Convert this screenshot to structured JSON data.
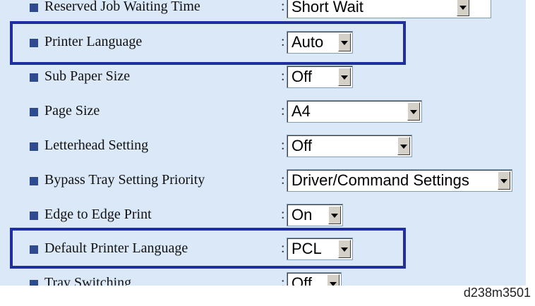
{
  "settings": [
    {
      "label": "Reserved Job Waiting Time",
      "value": "Short Wait"
    },
    {
      "label": "Printer Language",
      "value": "Auto"
    },
    {
      "label": "Sub Paper Size",
      "value": "Off"
    },
    {
      "label": "Page Size",
      "value": "A4"
    },
    {
      "label": "Letterhead Setting",
      "value": "Off"
    },
    {
      "label": "Bypass Tray Setting Priority",
      "value": "Driver/Command Settings"
    },
    {
      "label": "Edge to Edge Print",
      "value": "On"
    },
    {
      "label": "Default Printer Language",
      "value": "PCL"
    },
    {
      "label": "Tray Switching",
      "value": "Off"
    }
  ],
  "separator": ":",
  "figure_id": "d238m3501",
  "colors": {
    "panel_background": "#dbe8f7",
    "highlight_border": "#1f2fa0",
    "bullet": "#2f4a8f"
  }
}
